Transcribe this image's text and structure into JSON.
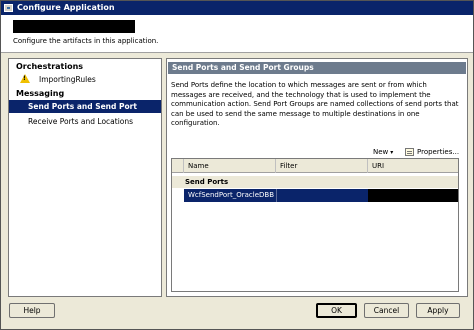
{
  "window": {
    "title": "Configure Application",
    "subtitle": "Configure the artifacts in this application."
  },
  "nav": {
    "orchestrations_header": "Orchestrations",
    "importing_rules": "ImportingRules",
    "messaging_header": "Messaging",
    "send_ports_item": "Send Ports and Send Port Groups",
    "receive_ports_item": "Receive Ports and Locations"
  },
  "panel": {
    "header": "Send Ports and Send Port Groups",
    "description": "Send Ports define the location to which messages are sent or from which messages are received, and the technology that is used to implement the communication action. Send Port Groups are named collections of send ports that can be used to send the same message to multiple destinations in one configuration."
  },
  "toolbar": {
    "new_label": "New",
    "properties_label": "Properties..."
  },
  "grid": {
    "columns": [
      "Name",
      "Filter",
      "URI"
    ],
    "group_label": "Send Ports",
    "rows": [
      {
        "name": "WcfSendPort_OracleDBBi...",
        "filter": "",
        "uri": ""
      }
    ]
  },
  "buttons": {
    "help": "Help",
    "ok": "OK",
    "cancel": "Cancel",
    "apply": "Apply"
  }
}
